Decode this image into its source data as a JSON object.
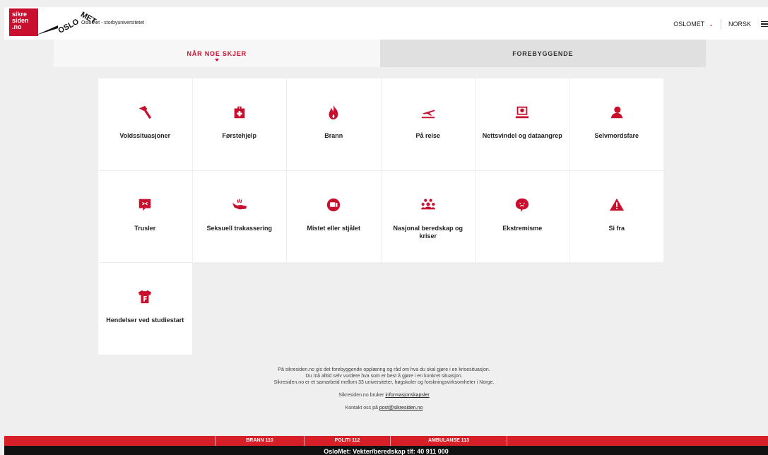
{
  "header": {
    "logo_sikresiden": [
      "sikre",
      "siden",
      ".no"
    ],
    "logo_oslomet": "OSLOMET",
    "site_name": "OsloMet - storbyuniversitetet",
    "org_menu": "OSLOMET",
    "language": "NORSK"
  },
  "tabs": [
    {
      "label": "NÅR NOE SKJER",
      "active": true
    },
    {
      "label": "FOREBYGGENDE",
      "active": false
    }
  ],
  "tiles": [
    {
      "label": "Voldssituasjoner",
      "icon": "hammer-icon"
    },
    {
      "label": "Førstehjelp",
      "icon": "first-aid-kit-icon"
    },
    {
      "label": "Brann",
      "icon": "fire-icon"
    },
    {
      "label": "På reise",
      "icon": "airplane-icon"
    },
    {
      "label": "Nettsvindel og dataangrep",
      "icon": "hacker-laptop-icon"
    },
    {
      "label": "Selvmordsfare",
      "icon": "person-icon"
    },
    {
      "label": "Trusler",
      "icon": "threat-speech-icon"
    },
    {
      "label": "Seksuell trakassering",
      "icon": "grabbing-hand-icon"
    },
    {
      "label": "Mistet eller stjålet",
      "icon": "lost-device-icon"
    },
    {
      "label": "Nasjonal beredskap og kriser",
      "icon": "group-icon"
    },
    {
      "label": "Ekstremisme",
      "icon": "angry-speech-icon"
    },
    {
      "label": "Si fra",
      "icon": "warning-icon"
    },
    {
      "label": "Hendelser ved studiestart",
      "icon": "tshirt-icon"
    }
  ],
  "info": {
    "line1": "På sikresiden.no gis det forebyggende opplæring og råd om hva du skal gjøre i en krisesituasjon.",
    "line2": "Du må alltid selv vurdere hva som er best å gjøre i en konkret situasjon.",
    "line3": "Sikresiden.no er et samarbeid mellom 33 universiteter, høgskoler og forskningsvirksomheter i Norge.",
    "cookies_prefix": "Sikresiden.no bruker ",
    "cookies_link": "informasjonskapsler",
    "contact_prefix": "Kontakt oss på ",
    "contact_link": "post@sikresiden.no"
  },
  "emergency": {
    "fire": "BRANN 110",
    "police": "POLITI 112",
    "ambulance": "AMBULANSE 113"
  },
  "bottom_bar": "OsloMet: Vekter/beredskap tlf: 40 911 000",
  "colors": {
    "accent": "#c8102e",
    "emergency_bar": "#d61f26",
    "bottom_bar": "#111111"
  }
}
